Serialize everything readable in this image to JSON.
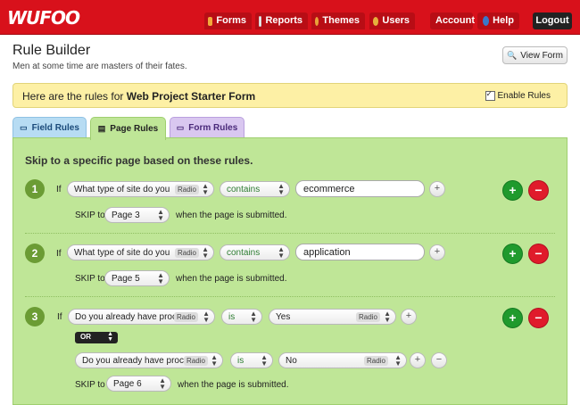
{
  "brand": {
    "logo_text": "WUFOO"
  },
  "nav": {
    "forms": "Forms",
    "reports": "Reports",
    "themes": "Themes",
    "users": "Users",
    "account": "Account",
    "help": "Help",
    "logout": "Logout"
  },
  "page": {
    "title": "Rule Builder",
    "subtitle": "Men at some time are masters of their fates.",
    "view_form": "View Form"
  },
  "banner": {
    "prefix": "Here are the rules for ",
    "form_name": "Web Project Starter Form",
    "enable_label": "Enable Rules"
  },
  "tabs": {
    "field_rules": "Field Rules",
    "page_rules": "Page Rules",
    "form_rules": "Form Rules"
  },
  "panel": {
    "heading": "Skip to a specific page based on these rules."
  },
  "common": {
    "if": "If",
    "skip_to": "SKIP to",
    "submitted_text": "when the page is submitted.",
    "radio_badge": "Radio",
    "plus": "+",
    "minus": "−",
    "or": "OR"
  },
  "rules": [
    {
      "number": "1",
      "field": "What type of site do you",
      "operator": "contains",
      "value": "ecommerce",
      "skip_page": "Page 3"
    },
    {
      "number": "2",
      "field": "What type of site do you",
      "operator": "contains",
      "value": "application",
      "skip_page": "Page 5"
    },
    {
      "number": "3",
      "field": "Do you already have proc",
      "operator": "is",
      "value": "Yes",
      "or_field": "Do you already have proc",
      "or_operator": "is",
      "or_value": "No",
      "skip_page": "Page 6"
    }
  ]
}
